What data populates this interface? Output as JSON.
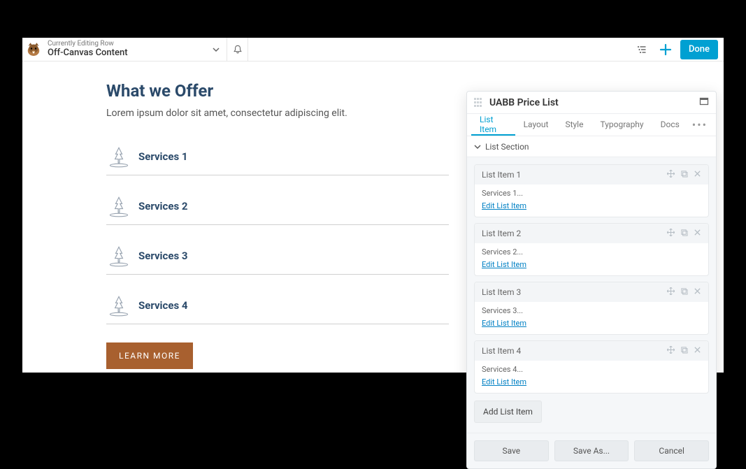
{
  "topbar": {
    "editing_label": "Currently Editing Row",
    "editing_title": "Off-Canvas Content",
    "done_label": "Done"
  },
  "canvas": {
    "heading": "What we Offer",
    "subheading": "Lorem ipsum dolor sit amet, consectetur adipiscing elit.",
    "services": [
      {
        "label": "Services 1"
      },
      {
        "label": "Services 2"
      },
      {
        "label": "Services 3"
      },
      {
        "label": "Services 4"
      }
    ],
    "cta_label": "LEARN MORE"
  },
  "panel": {
    "title": "UABB Price List",
    "tabs": [
      {
        "label": "List Item",
        "active": true
      },
      {
        "label": "Layout"
      },
      {
        "label": "Style"
      },
      {
        "label": "Typography"
      },
      {
        "label": "Docs"
      }
    ],
    "section_label": "List Section",
    "items": [
      {
        "head": "List Item 1",
        "name": "Services 1...",
        "edit": "Edit List Item"
      },
      {
        "head": "List Item 2",
        "name": "Services 2...",
        "edit": "Edit List Item"
      },
      {
        "head": "List Item 3",
        "name": "Services 3...",
        "edit": "Edit List Item"
      },
      {
        "head": "List Item 4",
        "name": "Services 4...",
        "edit": "Edit List Item"
      }
    ],
    "add_label": "Add List Item",
    "footer": {
      "save": "Save",
      "saveas": "Save As...",
      "cancel": "Cancel"
    }
  }
}
